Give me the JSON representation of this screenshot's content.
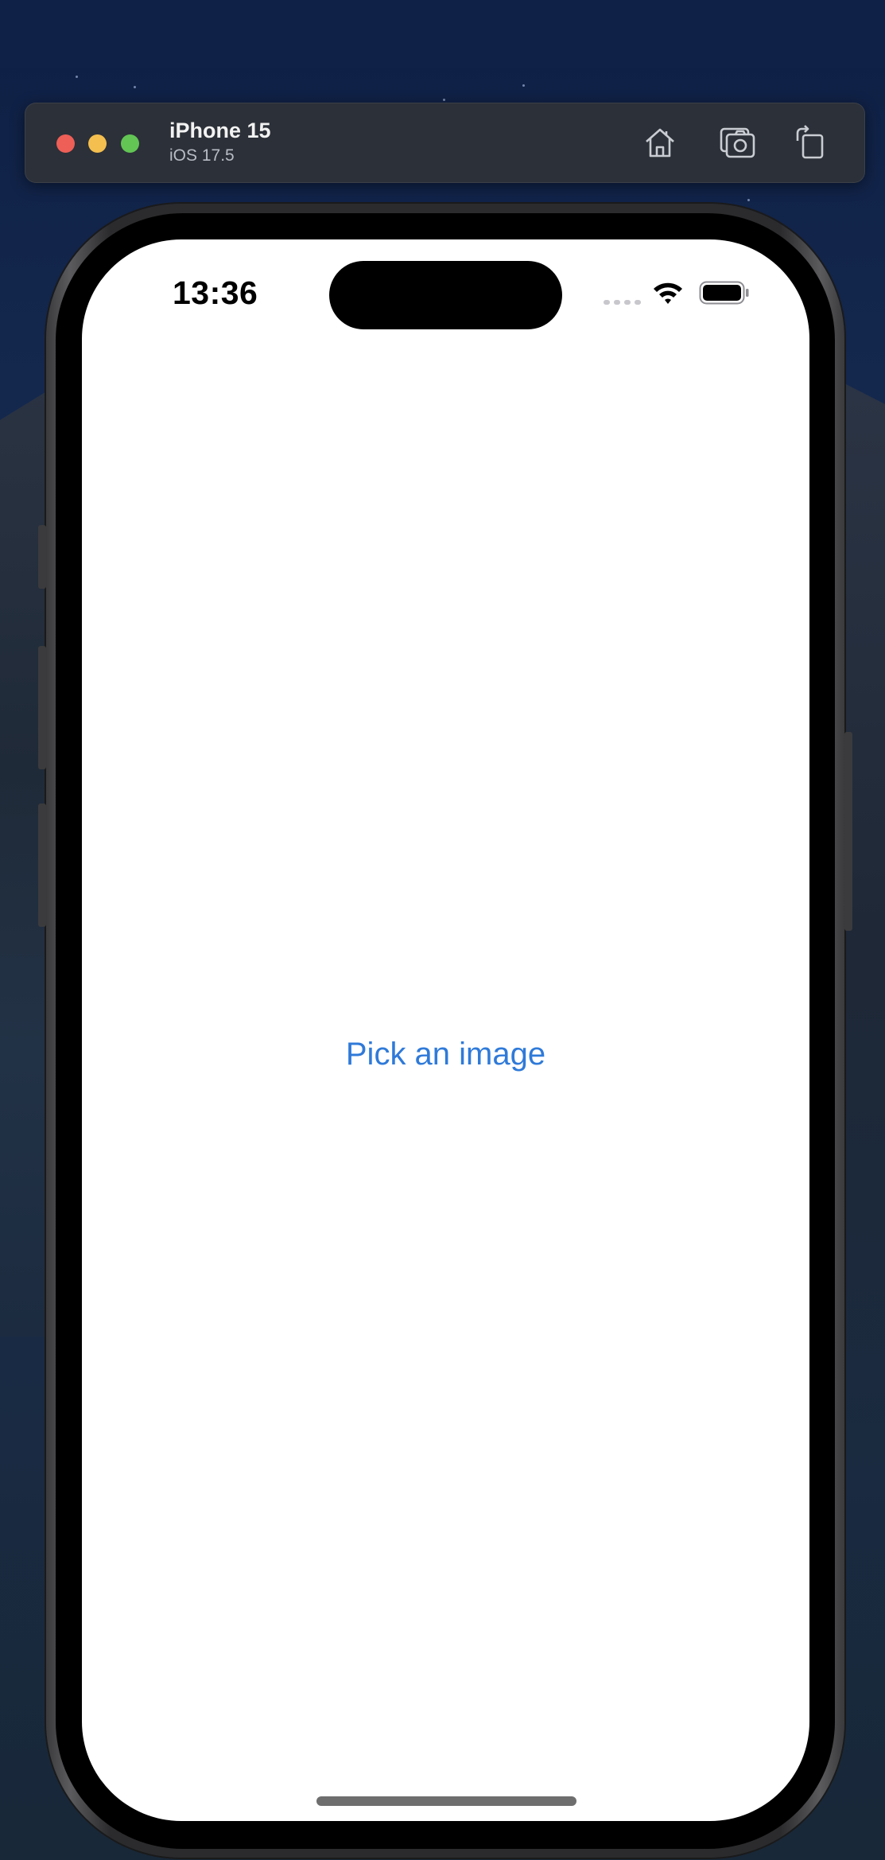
{
  "window": {
    "device_name": "iPhone 15",
    "os_version": "iOS 17.5",
    "toolbar_icons": [
      "home-icon",
      "screenshot-icon",
      "rotate-icon"
    ]
  },
  "status_bar": {
    "time": "13:36",
    "icons": [
      "cellular-signal-icon",
      "wifi-icon",
      "battery-icon"
    ]
  },
  "app": {
    "pick_button_label": "Pick an image"
  },
  "colors": {
    "accent": "#2f7ad9",
    "titlebar": "#2c3038",
    "traffic_red": "#ee5f57",
    "traffic_yellow": "#f4bf4f",
    "traffic_green": "#62c554"
  }
}
